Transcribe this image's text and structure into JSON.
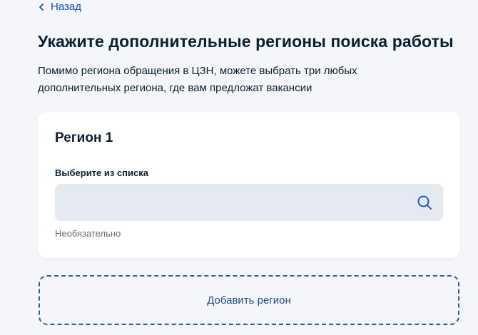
{
  "nav": {
    "back_label": "Назад"
  },
  "page": {
    "title": "Укажите дополнительные регионы поиска работы",
    "description": "Помимо региона обращения в ЦЗН, можете выбрать три любых дополнительных региона, где вам предложат вакансии"
  },
  "region_card": {
    "title": "Регион 1",
    "field_label": "Выберите из списка",
    "input_value": "",
    "input_placeholder": "",
    "hint": "Необязательно",
    "icon": "search-icon"
  },
  "actions": {
    "add_region_label": "Добавить регион"
  },
  "colors": {
    "background": "#f4f6f9",
    "link": "#0d4cd3",
    "text": "#0b1f33",
    "hint": "#66727f",
    "input_bg": "#e5eaf0",
    "dashed_border": "#2f5f9e"
  }
}
